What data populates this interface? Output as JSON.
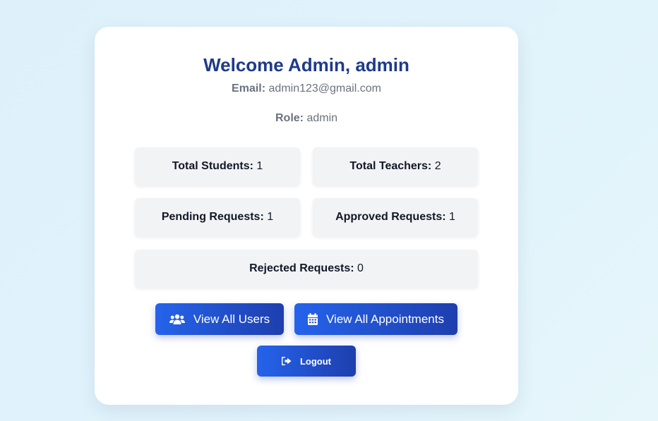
{
  "header": {
    "title": "Welcome Admin, admin",
    "email_label": "Email:",
    "email_value": "admin123@gmail.com",
    "role_label": "Role:",
    "role_value": "admin"
  },
  "stats": {
    "students": {
      "label": "Total Students:",
      "value": "1"
    },
    "teachers": {
      "label": "Total Teachers:",
      "value": "2"
    },
    "pending": {
      "label": "Pending Requests:",
      "value": "1"
    },
    "approved": {
      "label": "Approved Requests:",
      "value": "1"
    },
    "rejected": {
      "label": "Rejected Requests:",
      "value": "0"
    }
  },
  "actions": {
    "view_users": {
      "label": "View All Users",
      "icon": "users-icon"
    },
    "view_appointments": {
      "label": "View All Appointments",
      "icon": "calendar-icon"
    },
    "logout": {
      "label": "Logout",
      "icon": "sign-out-icon"
    }
  },
  "colors": {
    "title": "#1e3a8a",
    "button_start": "#2563eb",
    "button_end": "#1e3fae",
    "stat_background": "#f2f3f5",
    "page_background": "#def1fb"
  }
}
